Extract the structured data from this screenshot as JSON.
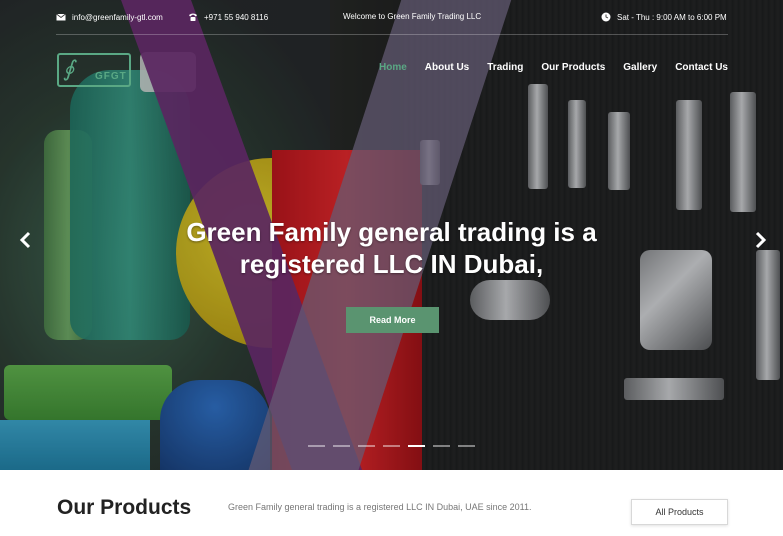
{
  "topbar": {
    "email": "info@greenfamily-gtl.com",
    "phone": "+971 55 940 8116",
    "welcome": "Welcome to Green Family Trading LLC",
    "hours": "Sat - Thu : 9:00 AM to 6:00 PM"
  },
  "logo": {
    "text": "GFGT"
  },
  "nav": {
    "items": [
      {
        "label": "Home",
        "active": true
      },
      {
        "label": "About Us"
      },
      {
        "label": "Trading"
      },
      {
        "label": "Our Products"
      },
      {
        "label": "Gallery"
      },
      {
        "label": "Contact Us"
      }
    ]
  },
  "hero": {
    "headline_line1": "Green Family general trading is a",
    "headline_line2": "registered LLC IN Dubai,",
    "button": "Read More",
    "prev_icon": "chevron-left-icon",
    "next_icon": "chevron-right-icon",
    "slide_count": 7,
    "active_slide": 5
  },
  "products": {
    "title": "Our Products",
    "description": "Green Family general trading is a registered LLC IN Dubai, UAE since 2011.",
    "button": "All Products"
  },
  "colors": {
    "accent": "#5a9470",
    "nav_active": "#5aa884"
  }
}
